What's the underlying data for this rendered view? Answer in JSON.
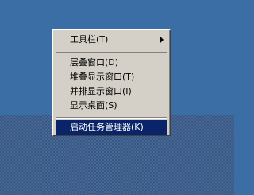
{
  "context_menu": {
    "items": [
      {
        "label": "工具栏(T)",
        "has_submenu": true
      },
      {
        "label": "层叠窗口(D)"
      },
      {
        "label": "堆叠显示窗口(T)"
      },
      {
        "label": "并排显示窗口(I)"
      },
      {
        "label": "显示桌面(S)"
      },
      {
        "label": "启动任务管理器(K)",
        "selected": true
      }
    ]
  },
  "colors": {
    "desktop": "#3A6EA5",
    "menu_background": "#D4D0C8",
    "selection": "#0A246A"
  },
  "icons": {
    "submenu_arrow": "submenu-arrow-icon"
  }
}
